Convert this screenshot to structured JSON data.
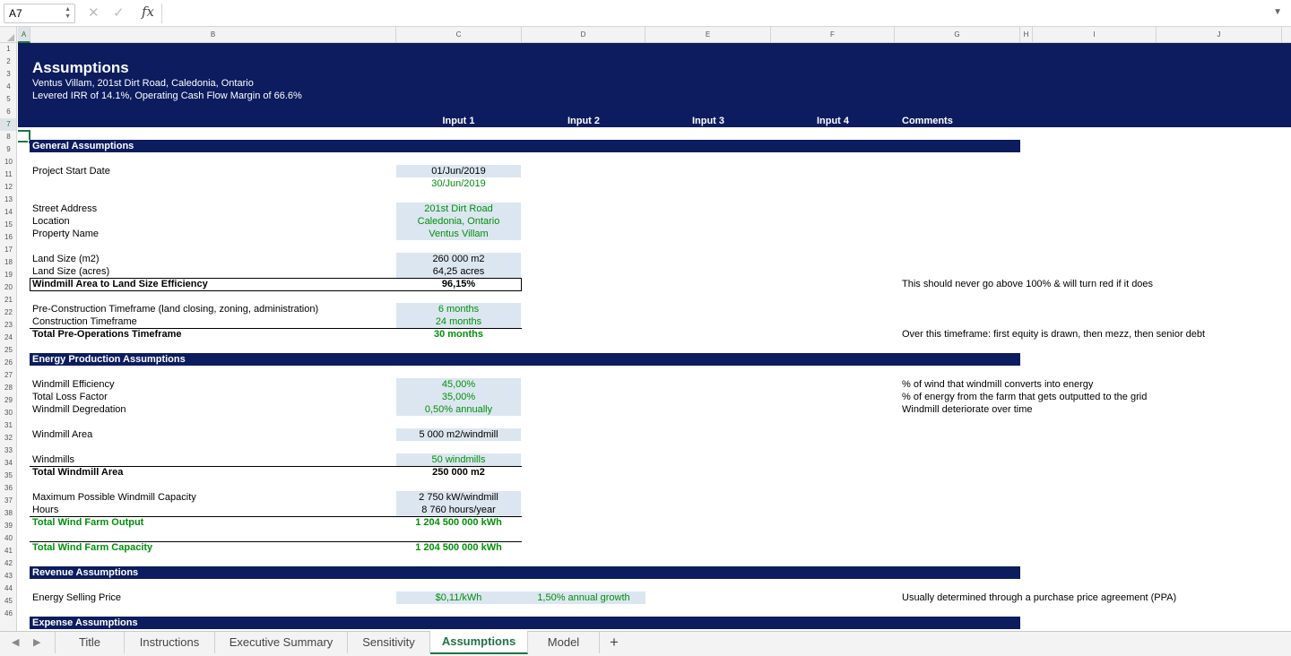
{
  "formula_bar": {
    "cell_ref": "A7",
    "formula": ""
  },
  "columns": [
    "A",
    "B",
    "C",
    "D",
    "E",
    "F",
    "G",
    "H",
    "I",
    "J"
  ],
  "rows": [
    "1",
    "2",
    "3",
    "4",
    "5",
    "6",
    "7",
    "8",
    "9",
    "10",
    "11",
    "12",
    "13",
    "14",
    "15",
    "16",
    "17",
    "18",
    "19",
    "20",
    "21",
    "22",
    "23",
    "24",
    "25",
    "26",
    "27",
    "28",
    "29",
    "30",
    "31",
    "32",
    "33",
    "34",
    "35",
    "36",
    "37",
    "38",
    "39",
    "40",
    "41",
    "42",
    "43",
    "44",
    "45",
    "46"
  ],
  "header": {
    "title": "Assumptions",
    "address": "Ventus Villam, 201st Dirt Road, Caledonia, Ontario",
    "summary": "Levered IRR of 14.1%, Operating Cash Flow Margin of 66.6%",
    "col_input1": "Input 1",
    "col_input2": "Input 2",
    "col_input3": "Input 3",
    "col_input4": "Input 4",
    "col_comments": "Comments"
  },
  "sections": {
    "general": "General Assumptions",
    "energy": "Energy Production Assumptions",
    "revenue": "Revenue Assumptions",
    "expense": "Expense Assumptions"
  },
  "cells": {
    "project_start_label": "Project Start Date",
    "project_start_value": "01/Jun/2019",
    "project_start_value2": "30/Jun/2019",
    "street_label": "Street Address",
    "street_value": "201st Dirt Road",
    "location_label": "Location",
    "location_value": "Caledonia, Ontario",
    "property_label": "Property Name",
    "property_value": "Ventus Villam",
    "land_m2_label": "Land Size (m2)",
    "land_m2_value": "260 000 m2",
    "land_acres_label": "Land Size (acres)",
    "land_acres_value": "64,25 acres",
    "efficiency_label": "Windmill Area to Land Size Efficiency",
    "efficiency_value": "96,15%",
    "efficiency_comment": "This should never go above 100% & will turn red if it does",
    "preconst_label": "Pre-Construction Timeframe (land closing, zoning, administration)",
    "preconst_value": "6 months",
    "const_label": "Construction Timeframe",
    "const_value": "24 months",
    "total_preops_label": "Total Pre-Operations Timeframe",
    "total_preops_value": "30 months",
    "total_preops_comment": "Over this timeframe: first equity is drawn, then mezz, then senior debt",
    "wm_eff_label": "Windmill Efficiency",
    "wm_eff_value": "45,00%",
    "wm_eff_comment": "% of wind that windmill converts into energy",
    "loss_label": "Total Loss Factor",
    "loss_value": "35,00%",
    "loss_comment": "% of energy from the farm that gets outputted to the grid",
    "degr_label": "Windmill Degredation",
    "degr_value": "0,50% annually",
    "degr_comment": "Windmill deteriorate over time",
    "wm_area_label": "Windmill Area",
    "wm_area_value": "5 000 m2/windmill",
    "windmills_label": "Windmills",
    "windmills_value": "50 windmills",
    "total_wm_area_label": "Total Windmill Area",
    "total_wm_area_value": "250 000 m2",
    "max_cap_label": "Maximum Possible Windmill Capacity",
    "max_cap_value": "2 750 kW/windmill",
    "hours_label": "Hours",
    "hours_value": "8 760 hours/year",
    "total_output_label": "Total Wind Farm Output",
    "total_output_value": "1 204 500 000 kWh",
    "total_capacity_label": "Total Wind Farm Capacity",
    "total_capacity_value": "1 204 500 000 kWh",
    "price_label": "Energy Selling Price",
    "price_value": "$0,11/kWh",
    "price_growth": "1,50% annual growth",
    "price_comment": "Usually determined through a purchase price agreement (PPA)"
  },
  "sheet_tabs": [
    {
      "label": "Title"
    },
    {
      "label": "Instructions"
    },
    {
      "label": "Executive Summary"
    },
    {
      "label": "Sensitivity"
    },
    {
      "label": "Assumptions"
    },
    {
      "label": "Model"
    }
  ],
  "colors": {
    "navy": "#0c1c5e",
    "green_text": "#00900a",
    "input_fill": "#dce6f0",
    "excel_green": "#217346"
  }
}
